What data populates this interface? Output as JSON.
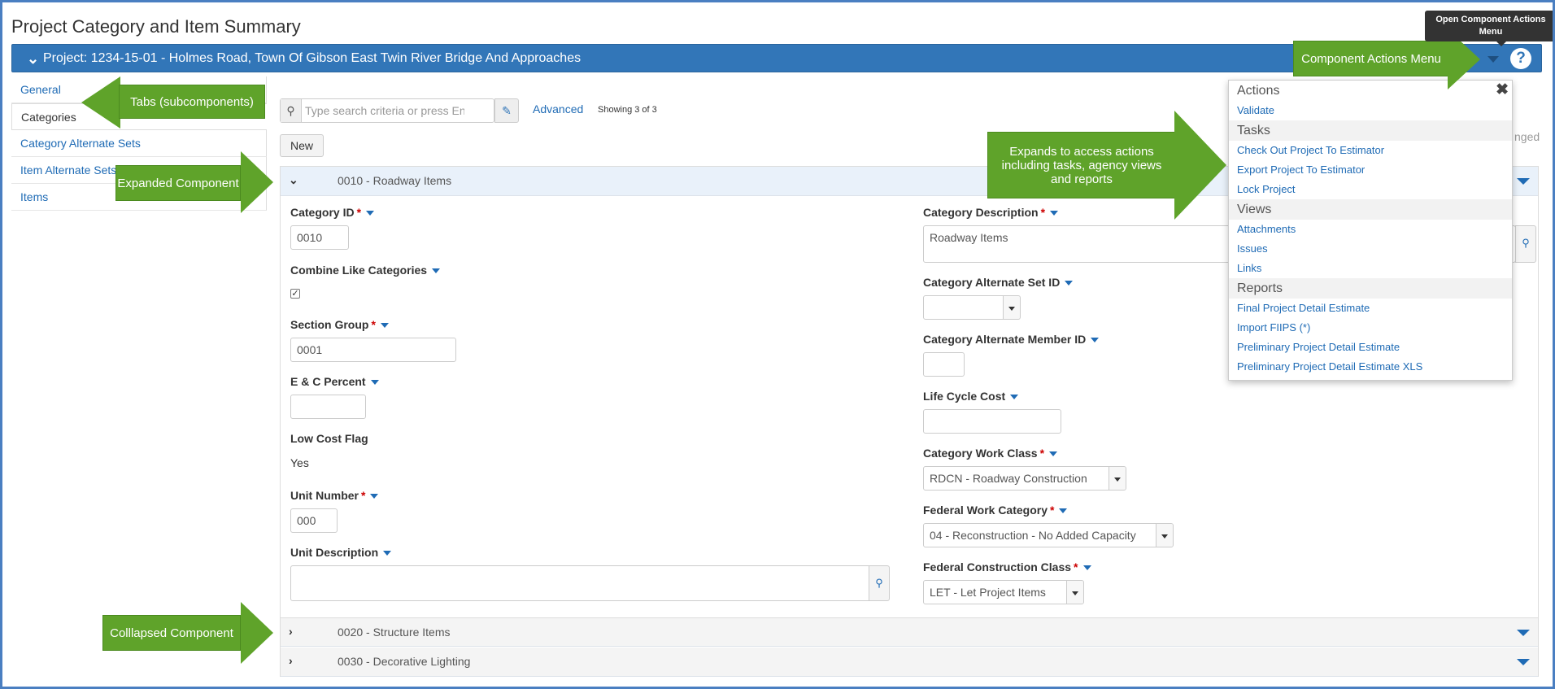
{
  "page": {
    "title": "Project Category and Item Summary",
    "project_label": "Project: 1234-15-01 - Holmes Road, Town Of Gibson East Twin River Bridge And Approaches",
    "tooltip": "Open Component Actions Menu",
    "help_glyph": "?"
  },
  "nav": {
    "items": [
      {
        "label": "General",
        "active": false
      },
      {
        "label": "Categories",
        "active": true
      },
      {
        "label": "Category Alternate Sets",
        "active": false
      },
      {
        "label": "Item Alternate Sets",
        "active": false
      },
      {
        "label": "Items",
        "active": false
      }
    ]
  },
  "toolbar": {
    "search_placeholder": "Type search criteria or press Enter",
    "advanced_label": "Advanced",
    "showing_text": "Showing 3 of 3",
    "changed_text": "nged",
    "new_label": "New"
  },
  "components": [
    {
      "title": "0010 - Roadway Items",
      "expanded": true
    },
    {
      "title": "0020 - Structure Items",
      "expanded": false
    },
    {
      "title": "0030 - Decorative Lighting",
      "expanded": false
    }
  ],
  "form": {
    "category_id": {
      "label": "Category ID",
      "value": "0010"
    },
    "combine_like": {
      "label": "Combine Like Categories",
      "checked": true
    },
    "section_group": {
      "label": "Section Group",
      "value": "0001"
    },
    "ec_percent": {
      "label": "E & C Percent",
      "value": ""
    },
    "low_cost_flag": {
      "label": "Low Cost Flag",
      "value": "Yes"
    },
    "unit_number": {
      "label": "Unit Number",
      "value": "000"
    },
    "unit_description": {
      "label": "Unit Description",
      "value": ""
    },
    "category_description": {
      "label": "Category Description",
      "value": "Roadway Items"
    },
    "cat_alt_set_id": {
      "label": "Category Alternate Set ID",
      "value": ""
    },
    "cat_alt_member_id": {
      "label": "Category Alternate Member ID",
      "value": ""
    },
    "life_cycle_cost": {
      "label": "Life Cycle Cost",
      "value": ""
    },
    "category_work_class": {
      "label": "Category Work Class",
      "value": "RDCN - Roadway Construction"
    },
    "federal_work_category": {
      "label": "Federal Work Category",
      "value": "04 - Reconstruction - No Added Capacity"
    },
    "federal_construction_class": {
      "label": "Federal Construction Class",
      "value": "LET - Let Project Items"
    }
  },
  "menu": {
    "sections": [
      {
        "title": "Actions",
        "items": [
          "Validate"
        ]
      },
      {
        "title": "Tasks",
        "items": [
          "Check Out Project To Estimator",
          "Export Project To Estimator",
          "Lock Project"
        ]
      },
      {
        "title": "Views",
        "items": [
          "Attachments",
          "Issues",
          "Links"
        ]
      },
      {
        "title": "Reports",
        "items": [
          "Final Project Detail Estimate",
          "Import FIIPS (*)",
          "Preliminary Project Detail Estimate",
          "Preliminary Project Detail Estimate XLS"
        ]
      }
    ]
  },
  "callouts": {
    "tabs": "Tabs (subcomponents)",
    "expanded": "Expanded Component",
    "collapsed": "Colllapsed Component",
    "actions_menu": "Component Actions Menu",
    "expands": "Expands to access actions including tasks, agency views and reports"
  },
  "colors": {
    "project_bar": "#3276b8",
    "link": "#1f6bb5",
    "callout": "#5fa32a",
    "required": "#cc0000"
  }
}
